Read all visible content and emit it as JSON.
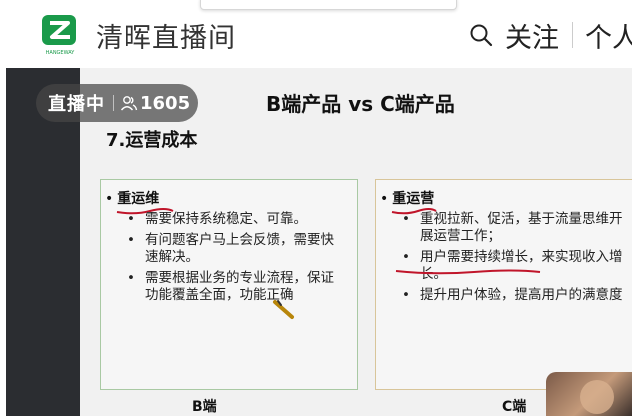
{
  "header": {
    "title": "清晖直播间",
    "follow_label": "关注",
    "personal_label": "个人",
    "logo_text": "HANGEWAY"
  },
  "live": {
    "status": "直播中",
    "viewers": "1605"
  },
  "slide": {
    "title": "B端产品 vs C端产品",
    "section": "7.运营成本",
    "b": {
      "heading": "重运维",
      "bullets": [
        "需要保持系统稳定、可靠。",
        "有问题客户马上会反馈，需要快速解决。",
        "需要根据业务的专业流程，保证功能覆盖全面，功能正确"
      ],
      "caption": "B端"
    },
    "c": {
      "heading": "重运营",
      "bullets": [
        "重视拉新、促活，基于流量思维开展运营工作；",
        "用户需要持续增长，来实现收入增长。",
        "提升用户体验，提高用户的满意度"
      ],
      "caption": "C端"
    }
  },
  "colors": {
    "brand_green": "#1a9a4a",
    "box_b_border": "#a9c9a3",
    "box_c_border": "#d8c59a",
    "annotation_red": "#c0152a",
    "live_pill": "#464646"
  },
  "icons": {
    "search": "search-icon",
    "viewers": "user-group-icon"
  }
}
